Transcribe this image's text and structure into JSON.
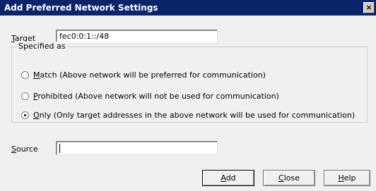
{
  "window": {
    "title": "Add Preferred Network Settings",
    "close_glyph": "×"
  },
  "target": {
    "label_key": "T",
    "label_rest": "arget",
    "value": "fec0:0:1::/48"
  },
  "group": {
    "legend": "Specified as",
    "options": [
      {
        "key": "M",
        "rest": "atch (Above network will be preferred for communication)",
        "checked": false
      },
      {
        "key": "P",
        "rest": "rohibited (Above network will not be used for communication)",
        "checked": false
      },
      {
        "key": "O",
        "rest": "nly (Only target addresses in the above network will be used for communication)",
        "checked": true
      }
    ]
  },
  "source": {
    "label_key": "S",
    "label_rest": "ource",
    "value": ""
  },
  "buttons": {
    "add": {
      "key": "A",
      "rest": "dd"
    },
    "close": {
      "key": "C",
      "rest": "lose"
    },
    "help": {
      "key": "H",
      "rest": "elp"
    }
  }
}
